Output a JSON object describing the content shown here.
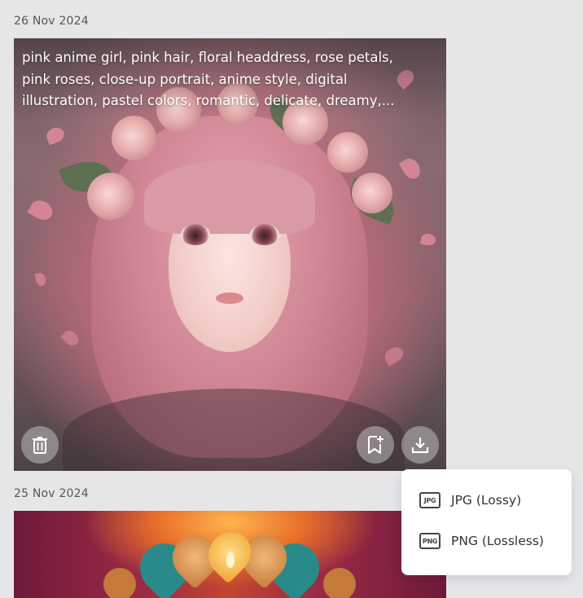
{
  "gallery": {
    "groups": [
      {
        "date": "26 Nov 2024",
        "prompt": "pink anime girl, pink hair, floral headdress, rose petals,\npink roses, close-up portrait, anime style, digital\nillustration, pastel colors, romantic, delicate, dreamy,..."
      },
      {
        "date": "25 Nov 2024"
      }
    ]
  },
  "icons": {
    "delete": "trash-icon",
    "save": "bookmark-plus-icon",
    "download": "download-icon",
    "jpg": "jpg-file-icon",
    "png": "png-file-icon"
  },
  "download_menu": {
    "items": [
      {
        "icon_text": "JPG",
        "label": "JPG (Lossy)"
      },
      {
        "icon_text": "PNG",
        "label": "PNG (Lossless)"
      }
    ]
  },
  "colors": {
    "background": "#e6e6e9",
    "menu_background": "#ffffff",
    "button_overlay": "#bebebe"
  }
}
